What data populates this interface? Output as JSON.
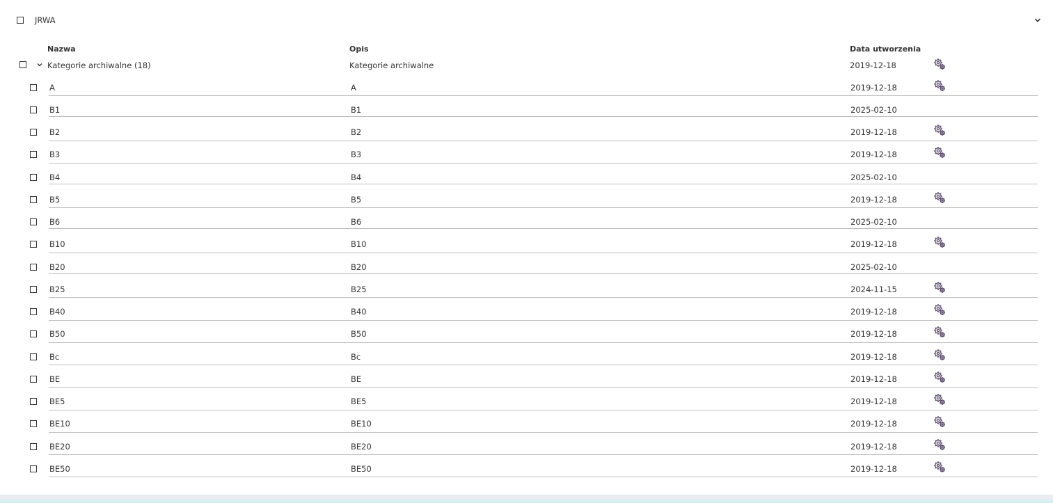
{
  "section": {
    "title": "JRWA"
  },
  "table": {
    "columns": {
      "name": "Nazwa",
      "description": "Opis",
      "created": "Data utworzenia"
    },
    "group": {
      "name": "Kategorie archiwalne (18)",
      "description": "Kategorie archiwalne",
      "created": "2019-12-18",
      "has_settings": true
    },
    "rows": [
      {
        "name": "A",
        "description": "A",
        "created": "2019-12-18",
        "has_settings": true
      },
      {
        "name": "B1",
        "description": "B1",
        "created": "2025-02-10",
        "has_settings": false
      },
      {
        "name": "B2",
        "description": "B2",
        "created": "2019-12-18",
        "has_settings": true
      },
      {
        "name": "B3",
        "description": "B3",
        "created": "2019-12-18",
        "has_settings": true
      },
      {
        "name": "B4",
        "description": "B4",
        "created": "2025-02-10",
        "has_settings": false
      },
      {
        "name": "B5",
        "description": "B5",
        "created": "2019-12-18",
        "has_settings": true
      },
      {
        "name": "B6",
        "description": "B6",
        "created": "2025-02-10",
        "has_settings": false
      },
      {
        "name": "B10",
        "description": "B10",
        "created": "2019-12-18",
        "has_settings": true
      },
      {
        "name": "B20",
        "description": "B20",
        "created": "2025-02-10",
        "has_settings": false
      },
      {
        "name": "B25",
        "description": "B25",
        "created": "2024-11-15",
        "has_settings": true
      },
      {
        "name": "B40",
        "description": "B40",
        "created": "2019-12-18",
        "has_settings": true
      },
      {
        "name": "B50",
        "description": "B50",
        "created": "2019-12-18",
        "has_settings": true
      },
      {
        "name": "Bc",
        "description": "Bc",
        "created": "2019-12-18",
        "has_settings": true
      },
      {
        "name": "BE",
        "description": "BE",
        "created": "2019-12-18",
        "has_settings": true
      },
      {
        "name": "BE5",
        "description": "BE5",
        "created": "2019-12-18",
        "has_settings": true
      },
      {
        "name": "BE10",
        "description": "BE10",
        "created": "2019-12-18",
        "has_settings": true
      },
      {
        "name": "BE20",
        "description": "BE20",
        "created": "2019-12-18",
        "has_settings": true
      },
      {
        "name": "BE50",
        "description": "BE50",
        "created": "2019-12-18",
        "has_settings": true
      }
    ]
  },
  "icons": {
    "settings": "gear-icon",
    "expand": "chevron-down-icon"
  },
  "colors": {
    "gear": "#5b4a6b",
    "divider": "#bdbdbd",
    "text": "#333333"
  }
}
